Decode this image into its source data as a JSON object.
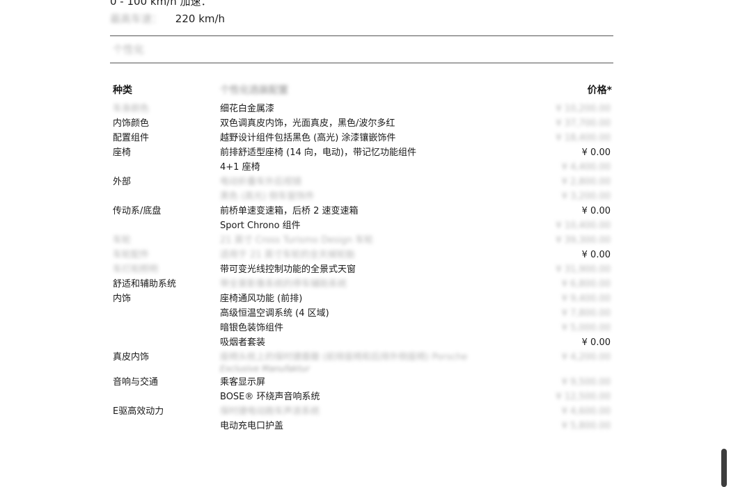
{
  "specs": [
    {
      "label": "0 - 100 km/h 加速：",
      "value": ""
    },
    {
      "label": "最高车速：",
      "value": "220 km/h"
    }
  ],
  "section_title": "个性化",
  "table": {
    "headers": {
      "category": "种类",
      "option": "个性化选装配置",
      "price": "价格*"
    },
    "rows": [
      {
        "category": "车身颜色",
        "option": "细花白金属漆",
        "price": "¥ 10,200.00",
        "cat_blur": true,
        "opt_blur": false,
        "price_blur": true
      },
      {
        "category": "内饰颜色",
        "option": "双色调真皮内饰，光面真皮，黑色/波尔多红",
        "price": "¥ 37,700.00",
        "cat_blur": false,
        "opt_blur": false,
        "price_blur": true
      },
      {
        "category": "配置组件",
        "option": "越野设计组件包括黑色 (高光) 涂漆镶嵌饰件",
        "price": "¥ 18,400.00",
        "cat_blur": false,
        "opt_blur": false,
        "price_blur": true
      },
      {
        "category": "座椅",
        "option": "前排舒适型座椅 (14 向，电动)，带记忆功能组件",
        "price": "¥ 0.00",
        "cat_blur": false,
        "opt_blur": false,
        "price_blur": false
      },
      {
        "category": "",
        "option": "4+1 座椅",
        "price": "¥ 4,400.00",
        "cat_blur": false,
        "opt_blur": false,
        "price_blur": true
      },
      {
        "category": "外部",
        "option": "电动折叠车外后视镜",
        "price": "¥ 2,800.00",
        "cat_blur": false,
        "opt_blur": true,
        "price_blur": true
      },
      {
        "category": "",
        "option": "黑色 (高光) 侧车窗饰件",
        "price": "¥ 3,200.00",
        "cat_blur": false,
        "opt_blur": true,
        "price_blur": true
      },
      {
        "category": "传动系/底盘",
        "option": "前桥单速变速箱，后桥 2 速变速箱",
        "price": "¥ 0.00",
        "cat_blur": false,
        "opt_blur": false,
        "price_blur": false
      },
      {
        "category": "",
        "option": "Sport Chrono 组件",
        "price": "¥ 10,400.00",
        "cat_blur": false,
        "opt_blur": false,
        "price_blur": true
      },
      {
        "category": "车轮",
        "option": "21 英寸 Cross Turismo Design 车轮",
        "price": "¥ 39,300.00",
        "cat_blur": true,
        "opt_blur": true,
        "price_blur": true
      },
      {
        "category": "车轮配件",
        "option": "适用于 21 英寸车轮的全天候轮胎",
        "price": "¥ 0.00",
        "cat_blur": true,
        "opt_blur": true,
        "price_blur": false
      },
      {
        "category": "车灯和照明",
        "option": "带可变光线控制功能的全景式天窗",
        "price": "¥ 31,900.00",
        "cat_blur": true,
        "opt_blur": false,
        "price_blur": true
      },
      {
        "category": "舒适和辅助系统",
        "option": "带全景影像系统的停车辅助系统",
        "price": "¥ 6,800.00",
        "cat_blur": false,
        "opt_blur": true,
        "price_blur": true
      },
      {
        "category": "内饰",
        "option": "座椅通风功能 (前排)",
        "price": "¥ 9,400.00",
        "cat_blur": false,
        "opt_blur": false,
        "price_blur": true
      },
      {
        "category": "",
        "option": "高级恒温空调系统 (4 区域)",
        "price": "¥ 7,800.00",
        "cat_blur": false,
        "opt_blur": false,
        "price_blur": true
      },
      {
        "category": "",
        "option": "暗银色装饰组件",
        "price": "¥ 5,000.00",
        "cat_blur": false,
        "opt_blur": false,
        "price_blur": true
      },
      {
        "category": "",
        "option": "吸烟者套装",
        "price": "¥ 0.00",
        "cat_blur": false,
        "opt_blur": false,
        "price_blur": false
      },
      {
        "category": "真皮内饰",
        "option": "座椅头枕上的保时捷盾徽 (前排座椅和后排外侧座椅) Porsche",
        "sub": "Exclusive Manufaktur",
        "price": "¥ 4,200.00",
        "cat_blur": false,
        "opt_blur": true,
        "price_blur": true,
        "tall": true
      },
      {
        "category": "音响与交通",
        "option": "乘客显示屏",
        "price": "¥ 9,500.00",
        "cat_blur": false,
        "opt_blur": false,
        "price_blur": true
      },
      {
        "category": "",
        "option": "BOSE® 环绕声音响系统",
        "price": "¥ 12,500.00",
        "cat_blur": false,
        "opt_blur": false,
        "price_blur": true
      },
      {
        "category": "E驱高效动力",
        "option": "保时捷电动跑车声浪系统",
        "price": "¥ 4,600.00",
        "cat_blur": false,
        "opt_blur": true,
        "price_blur": true
      },
      {
        "category": "",
        "option": "电动充电口护盖",
        "price": "¥ 5,800.00",
        "cat_blur": false,
        "opt_blur": false,
        "price_blur": true
      }
    ]
  }
}
